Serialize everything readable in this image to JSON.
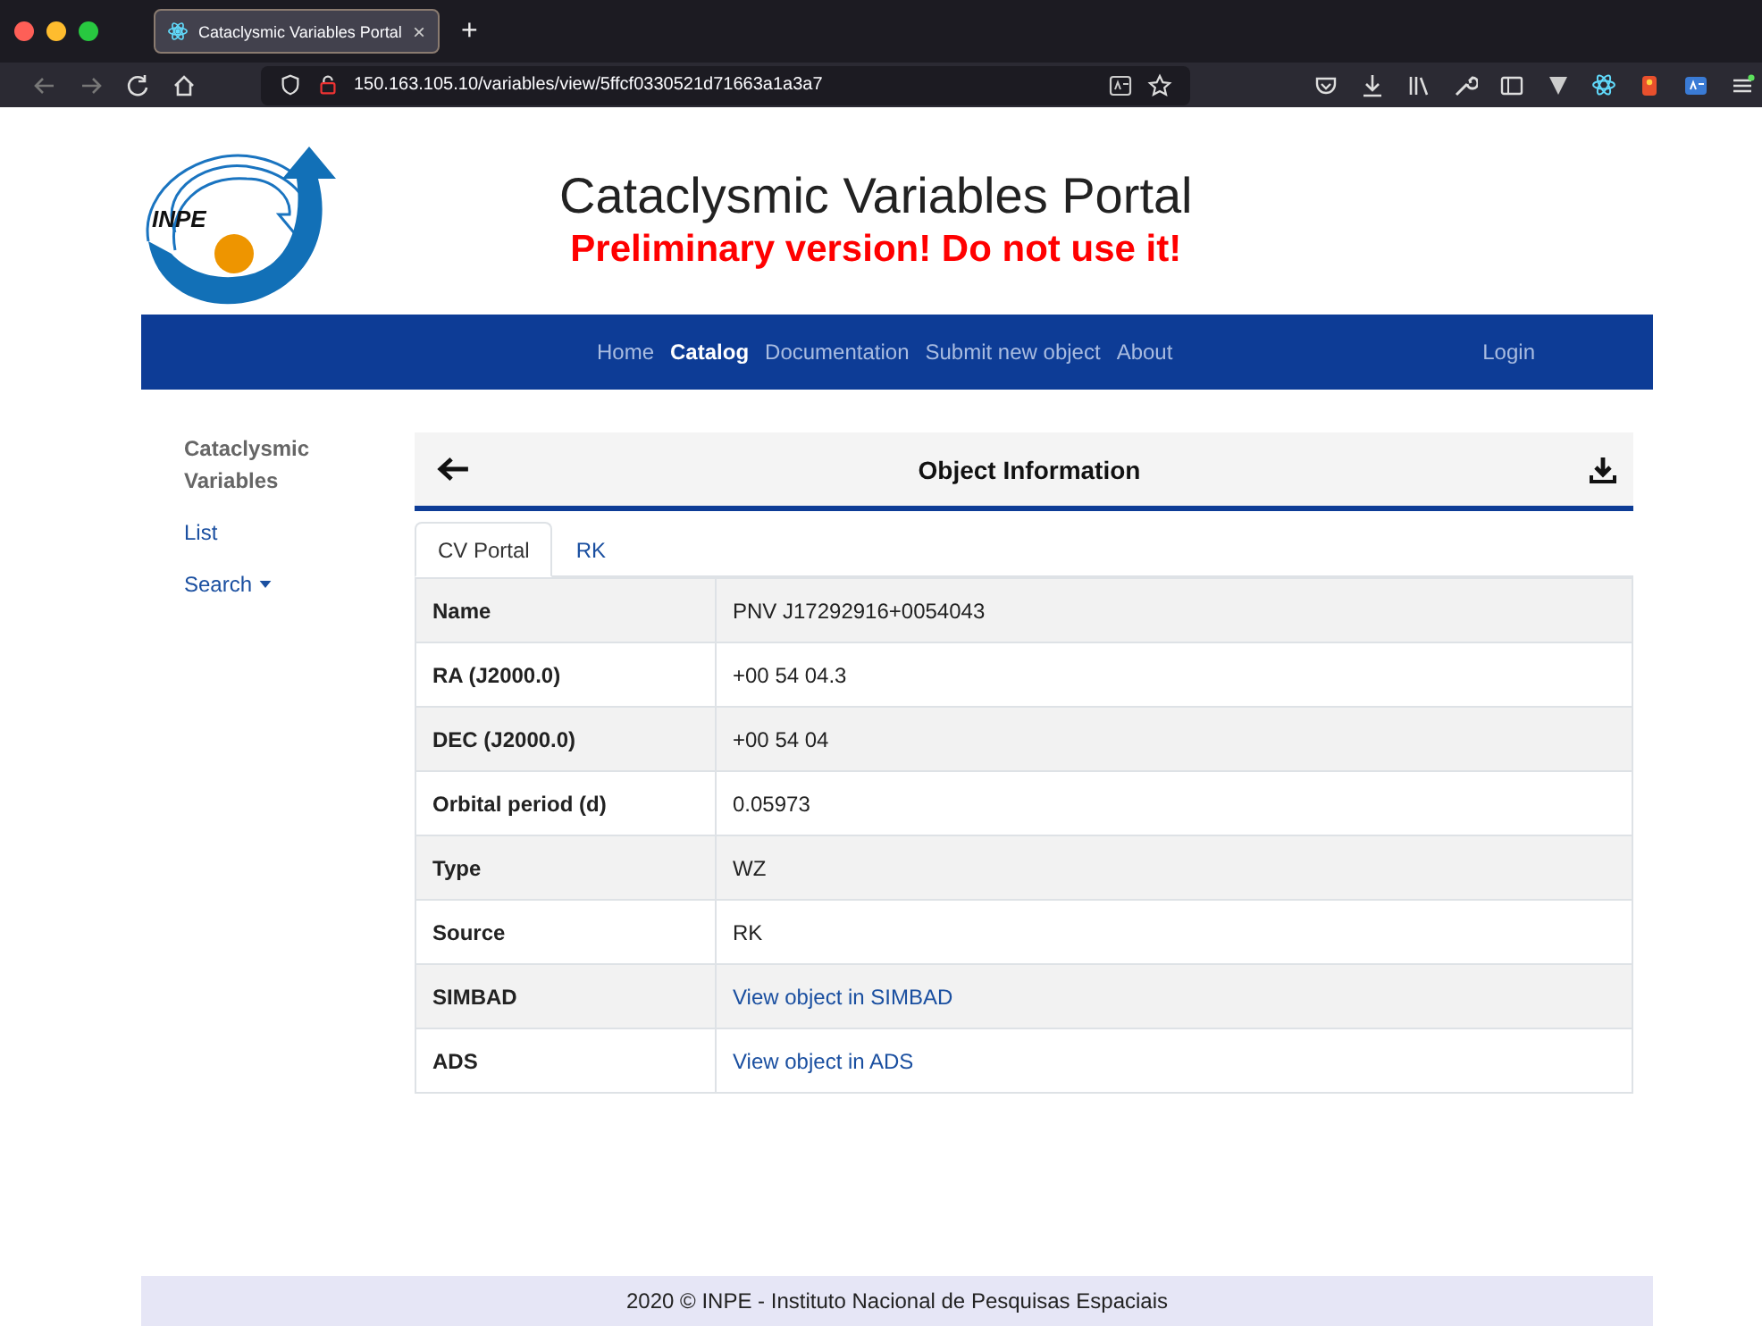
{
  "browser": {
    "tab_title": "Cataclysmic Variables Portal",
    "new_tab": "+",
    "close": "×",
    "url": "150.163.105.10/variables/view/5ffcf0330521d71663a1a3a7"
  },
  "header": {
    "logo_text": "INPE",
    "title": "Cataclysmic Variables Portal",
    "subtitle": "Preliminary version! Do not use it!"
  },
  "nav": {
    "items": [
      {
        "label": "Home",
        "selected": false
      },
      {
        "label": "Catalog",
        "selected": true
      },
      {
        "label": "Documentation",
        "selected": false
      },
      {
        "label": "Submit new object",
        "selected": false
      },
      {
        "label": "About",
        "selected": false
      }
    ],
    "login": "Login"
  },
  "sidebar": {
    "heading": "Cataclysmic Variables",
    "items": [
      {
        "label": "List",
        "dropdown": false
      },
      {
        "label": "Search",
        "dropdown": true
      }
    ]
  },
  "card": {
    "title": "Object Information",
    "tabs": [
      {
        "label": "CV Portal",
        "selected": true
      },
      {
        "label": "RK",
        "selected": false
      }
    ],
    "rows": [
      {
        "field": "Name",
        "value": "PNV J17292916+0054043",
        "kind": "text"
      },
      {
        "field": "RA (J2000.0)",
        "value": "+00 54 04.3",
        "kind": "text"
      },
      {
        "field": "DEC (J2000.0)",
        "value": "+00 54 04",
        "kind": "text"
      },
      {
        "field": "Orbital period (d)",
        "value": "0.05973",
        "kind": "text"
      },
      {
        "field": "Type",
        "value": "WZ",
        "kind": "text"
      },
      {
        "field": "Source",
        "value": "RK",
        "kind": "text"
      },
      {
        "field": "SIMBAD",
        "value": "View object in SIMBAD",
        "kind": "link"
      },
      {
        "field": "ADS",
        "value": "View object in ADS",
        "kind": "link"
      }
    ]
  },
  "footer": "2020 © INPE - Instituto Nacional de Pesquisas Espaciais"
}
